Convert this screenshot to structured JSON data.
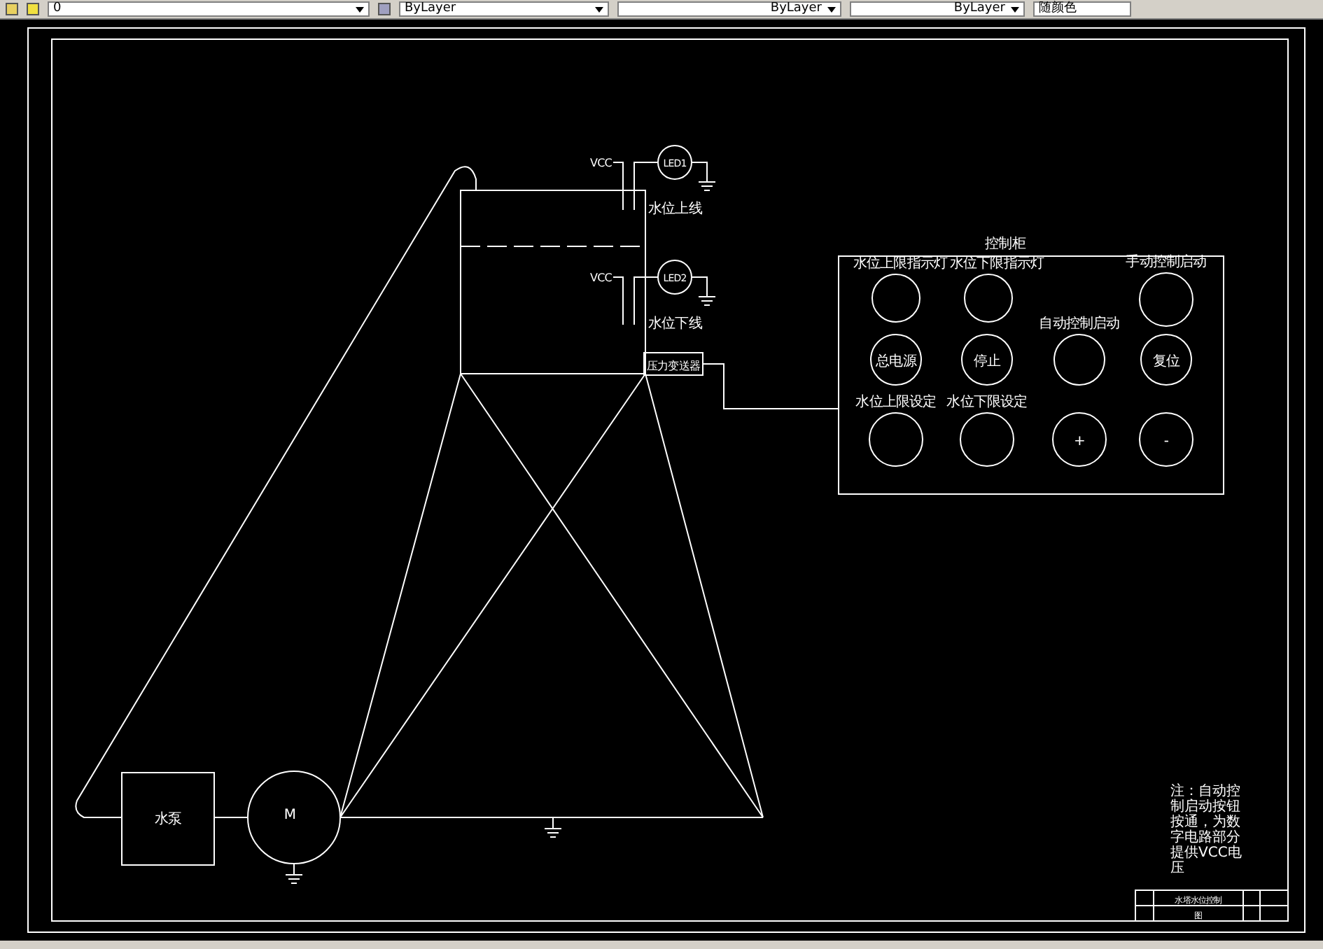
{
  "toolbar": {
    "layer": "0",
    "color_control": "ByLayer",
    "linetype": "ByLayer",
    "lineweight": "ByLayer",
    "plot_style": "随颜色"
  },
  "drawing": {
    "vcc_labels": [
      "VCC",
      "VCC"
    ],
    "led_labels": [
      "LED1",
      "LED2"
    ],
    "level_labels": [
      "水位上线",
      "水位下线"
    ],
    "sensor": "压力变送器",
    "pump": "水泵",
    "motor": "M",
    "panel": {
      "title": "控制柜",
      "buttons": [
        {
          "label": "水位上限指示灯"
        },
        {
          "label": "水位下限指示灯"
        },
        {
          "label": "手动控制启动"
        },
        {
          "text": "总电源"
        },
        {
          "text": "停止"
        },
        {
          "label": "自动控制启动"
        },
        {
          "text": "复位"
        },
        {
          "label": "水位上限设定"
        },
        {
          "label": "水位下限设定"
        },
        {
          "text": "+"
        },
        {
          "text": "-"
        }
      ]
    },
    "note": "注：自动控制启动按钮按通，为数字电路部分提供VCC电压",
    "title_block": {
      "name": "水塔水位控制",
      "sheet": "图"
    }
  }
}
